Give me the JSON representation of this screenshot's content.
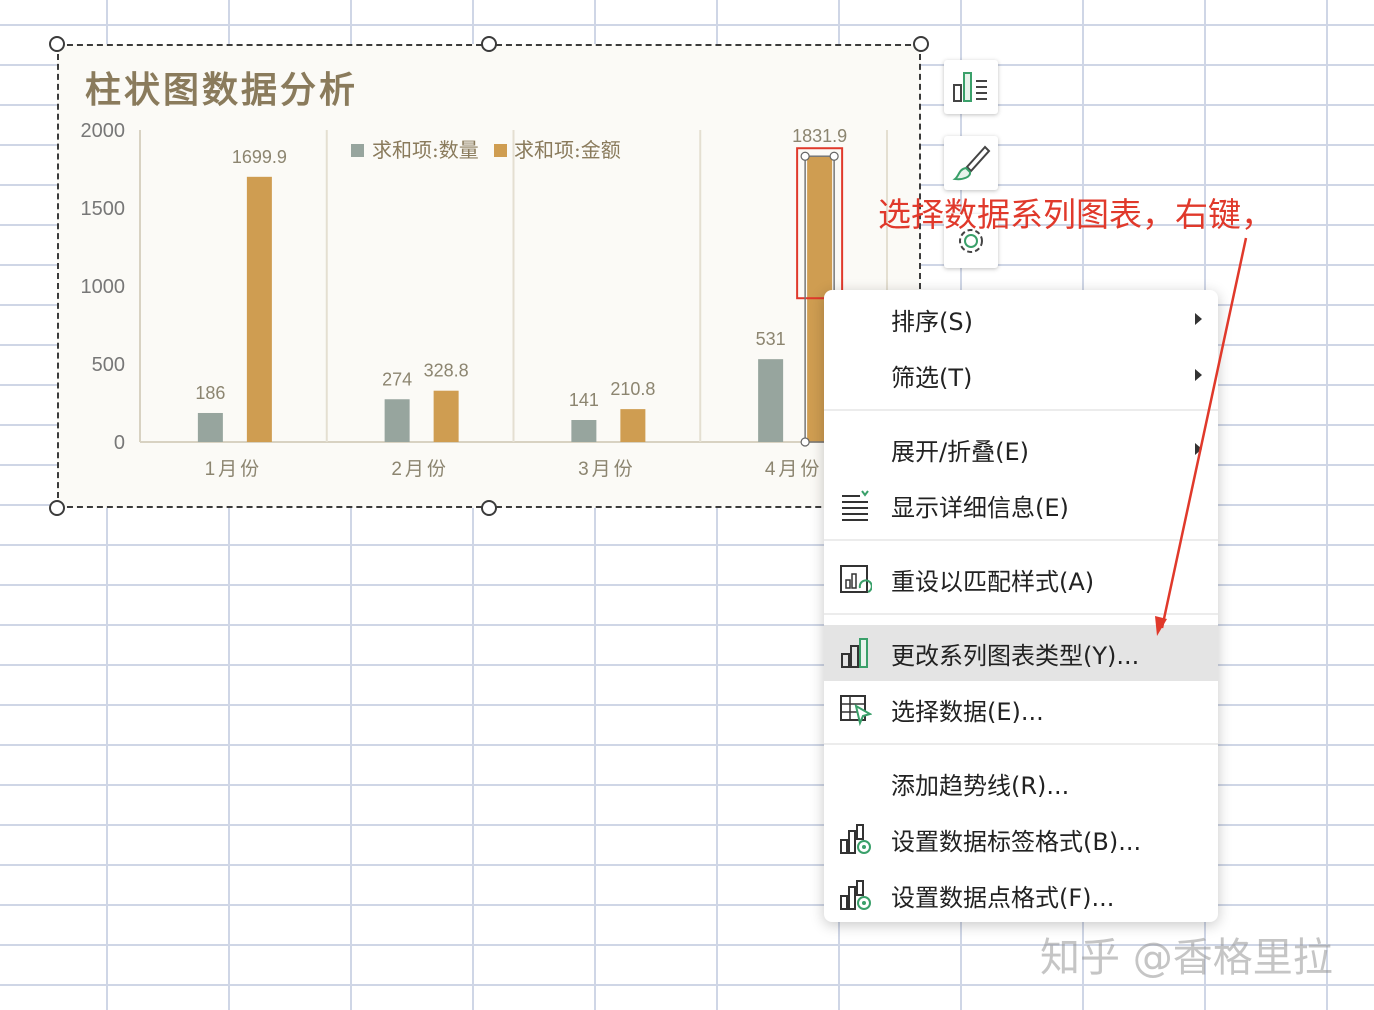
{
  "chart": {
    "title": "柱状图数据分析",
    "legend": [
      "求和项:数量",
      "求和项:金额"
    ]
  },
  "chart_data": {
    "type": "bar",
    "title": "柱状图数据分析",
    "categories": [
      "1月份",
      "2月份",
      "3月份",
      "4月份"
    ],
    "series": [
      {
        "name": "求和项:数量",
        "values": [
          186,
          274,
          141,
          531
        ],
        "color": "#97a59e"
      },
      {
        "name": "求和项:金额",
        "values": [
          1699.9,
          328.8,
          210.8,
          1831.9
        ],
        "color": "#cf9d51"
      }
    ],
    "ylim": [
      0,
      2000
    ],
    "yticks": [
      "0",
      "500",
      "1000",
      "1500",
      "2000"
    ],
    "data_labels": [
      [
        "186",
        "274",
        "141",
        "531"
      ],
      [
        "1699.9",
        "328.8",
        "210.8",
        "1831.9"
      ]
    ],
    "legend_position": "top",
    "grid": "vertical category separators",
    "xlabel": "",
    "ylabel": ""
  },
  "side_buttons": [
    {
      "icon": "chart-elements-icon"
    },
    {
      "icon": "chart-style-brush-icon"
    },
    {
      "icon": "gear-icon"
    }
  ],
  "annotation": "选择数据系列图表，右键，",
  "context_menu": {
    "items": [
      {
        "label": "排序(S)",
        "icon": "",
        "submenu": true
      },
      {
        "label": "筛选(T)",
        "icon": "",
        "submenu": true
      },
      {
        "label": "展开/折叠(E)",
        "icon": "",
        "submenu": true
      },
      {
        "label": "显示详细信息(E)",
        "icon": "show-details-icon",
        "submenu": false
      },
      {
        "label": "重设以匹配样式(A)",
        "icon": "reset-style-icon",
        "submenu": false
      },
      {
        "label": "更改系列图表类型(Y)...",
        "icon": "change-chart-type-icon",
        "submenu": false,
        "highlighted": true
      },
      {
        "label": "选择数据(E)...",
        "icon": "select-data-icon",
        "submenu": false
      },
      {
        "label": "添加趋势线(R)...",
        "icon": "",
        "submenu": false
      },
      {
        "label": "设置数据标签格式(B)...",
        "icon": "format-data-labels-icon",
        "submenu": false
      },
      {
        "label": "设置数据点格式(F)...",
        "icon": "format-data-point-icon",
        "submenu": false
      }
    ]
  },
  "watermark": "知乎 @香格里拉",
  "colors": {
    "accent_red": "#e0392b",
    "bar_quantity": "#97a59e",
    "bar_amount": "#cf9d51",
    "title": "#8a7b5c"
  }
}
